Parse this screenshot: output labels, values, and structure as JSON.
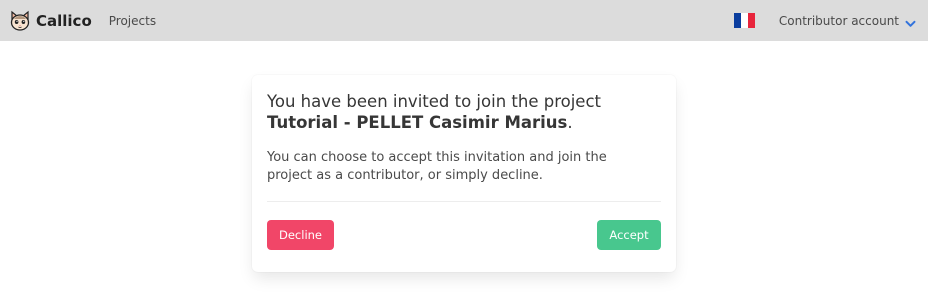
{
  "navbar": {
    "brand_name": "Callico",
    "brand_icon": "cat-face-icon",
    "projects_link": "Projects",
    "language_flag": "french-flag-icon",
    "flag_colors": [
      "#0a3d9e",
      "#ffffff",
      "#e8253c"
    ],
    "account_label": "Contributor account",
    "account_icon": "chevron-down-icon"
  },
  "invitation": {
    "title_prefix": "You have been invited to join the project",
    "project_name": "Tutorial - PELLET Casimir Marius",
    "title_suffix": ".",
    "description": "You can choose to accept this invitation and join the project as a contributor, or simply decline.",
    "decline_label": "Decline",
    "accept_label": "Accept"
  },
  "colors": {
    "navbar_bg": "#dcdcdc",
    "decline": "#f14668",
    "accept": "#48c78e",
    "chevron": "#3273dc"
  }
}
